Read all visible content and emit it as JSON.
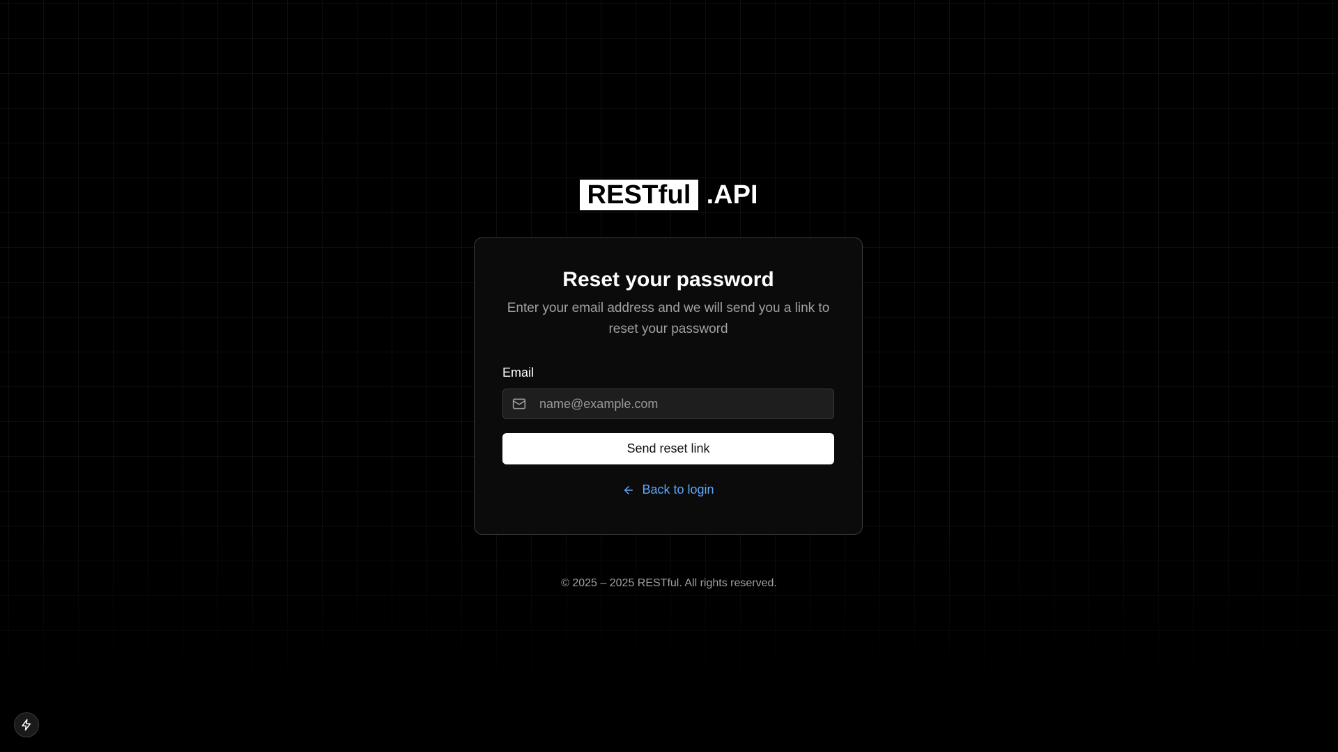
{
  "logo": {
    "badge_text": "RESTful",
    "suffix_text": ".API"
  },
  "card": {
    "title": "Reset your password",
    "description": "Enter your email address and we will send you a link to reset your password",
    "email_label": "Email",
    "email_placeholder": "name@example.com",
    "email_value": "",
    "email_icon": "mail-icon",
    "submit_label": "Send reset link",
    "back_link_label": "Back to login",
    "back_link_icon": "arrow-left-icon"
  },
  "footer": {
    "copyright": "© 2025 – 2025 RESTful. All rights reserved."
  },
  "corner_button": {
    "icon": "lightning-bolt-icon"
  },
  "colors": {
    "background": "#000000",
    "card_background": "#0b0b0b",
    "card_border": "#3a3a3a",
    "link": "#60a5fa",
    "primary_button": "#ffffff",
    "muted_text": "#a1a1a1"
  }
}
